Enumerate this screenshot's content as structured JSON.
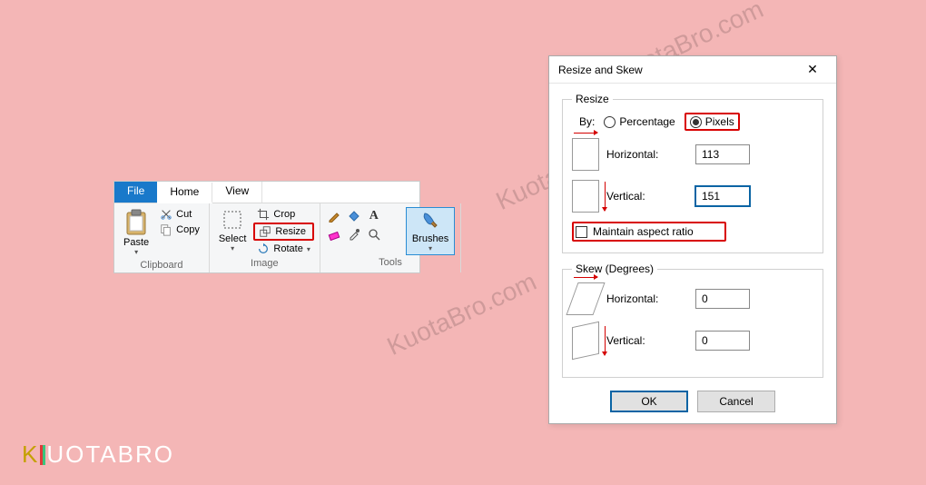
{
  "watermark": "KuotaBro.com",
  "ribbon": {
    "tabs": {
      "file": "File",
      "home": "Home",
      "view": "View"
    },
    "clipboard": {
      "label": "Clipboard",
      "paste": "Paste",
      "cut": "Cut",
      "copy": "Copy"
    },
    "image": {
      "label": "Image",
      "select": "Select",
      "crop": "Crop",
      "resize": "Resize",
      "rotate": "Rotate"
    },
    "tools": {
      "label": "Tools",
      "brushes": "Brushes"
    }
  },
  "dialog": {
    "title": "Resize and Skew",
    "resize": {
      "legend": "Resize",
      "byLabel": "By:",
      "percentage": "Percentage",
      "pixels": "Pixels",
      "horizontal": "Horizontal:",
      "vertical": "Vertical:",
      "hValue": "113",
      "vValue": "151",
      "maintain": "Maintain aspect ratio"
    },
    "skew": {
      "legend": "Skew (Degrees)",
      "horizontal": "Horizontal:",
      "vertical": "Vertical:",
      "hValue": "0",
      "vValue": "0"
    },
    "ok": "OK",
    "cancel": "Cancel"
  },
  "logo": {
    "part1": "K",
    "part2": "UOTA",
    "part3": "BRO"
  }
}
